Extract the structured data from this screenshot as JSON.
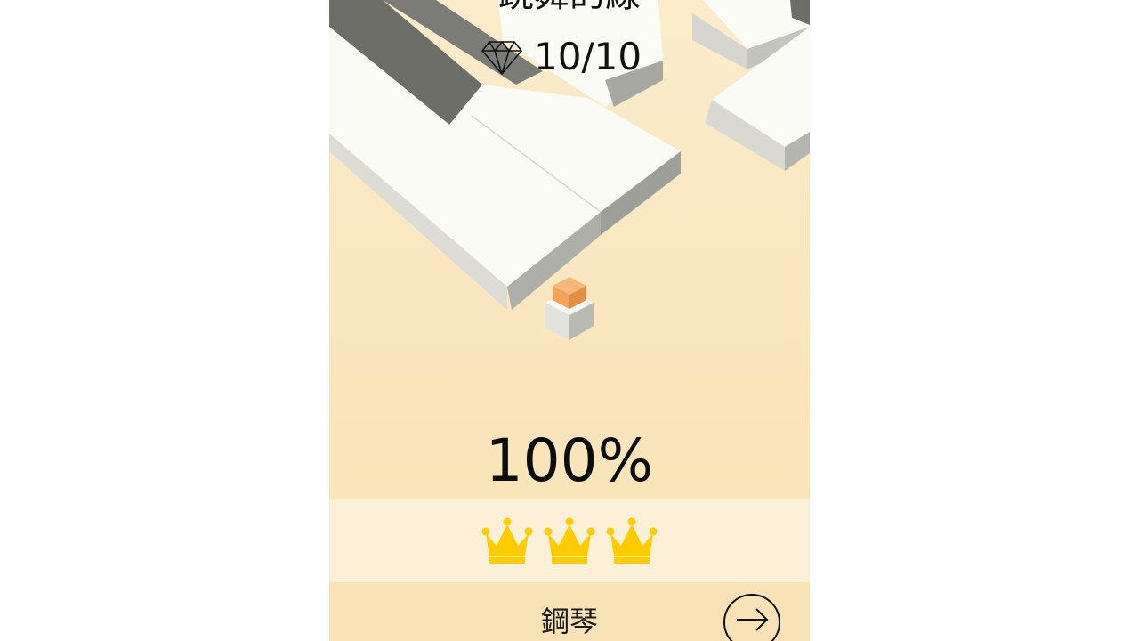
{
  "game": {
    "title": "跳舞的線",
    "gems": {
      "icon": "diamond-icon",
      "count": "10/10"
    },
    "progress": "100%",
    "crowns": {
      "earned": 3,
      "total": 3,
      "icon": "crown-icon",
      "color": "#ffcc00"
    },
    "song": "鋼琴",
    "next": {
      "icon": "arrow-right-icon"
    }
  },
  "colors": {
    "background": "#fae5bd",
    "block_top": "#fbfbf6",
    "block_side": "#9c9d97",
    "dark_key": "#6e6e68",
    "player": "#f1a35a"
  }
}
